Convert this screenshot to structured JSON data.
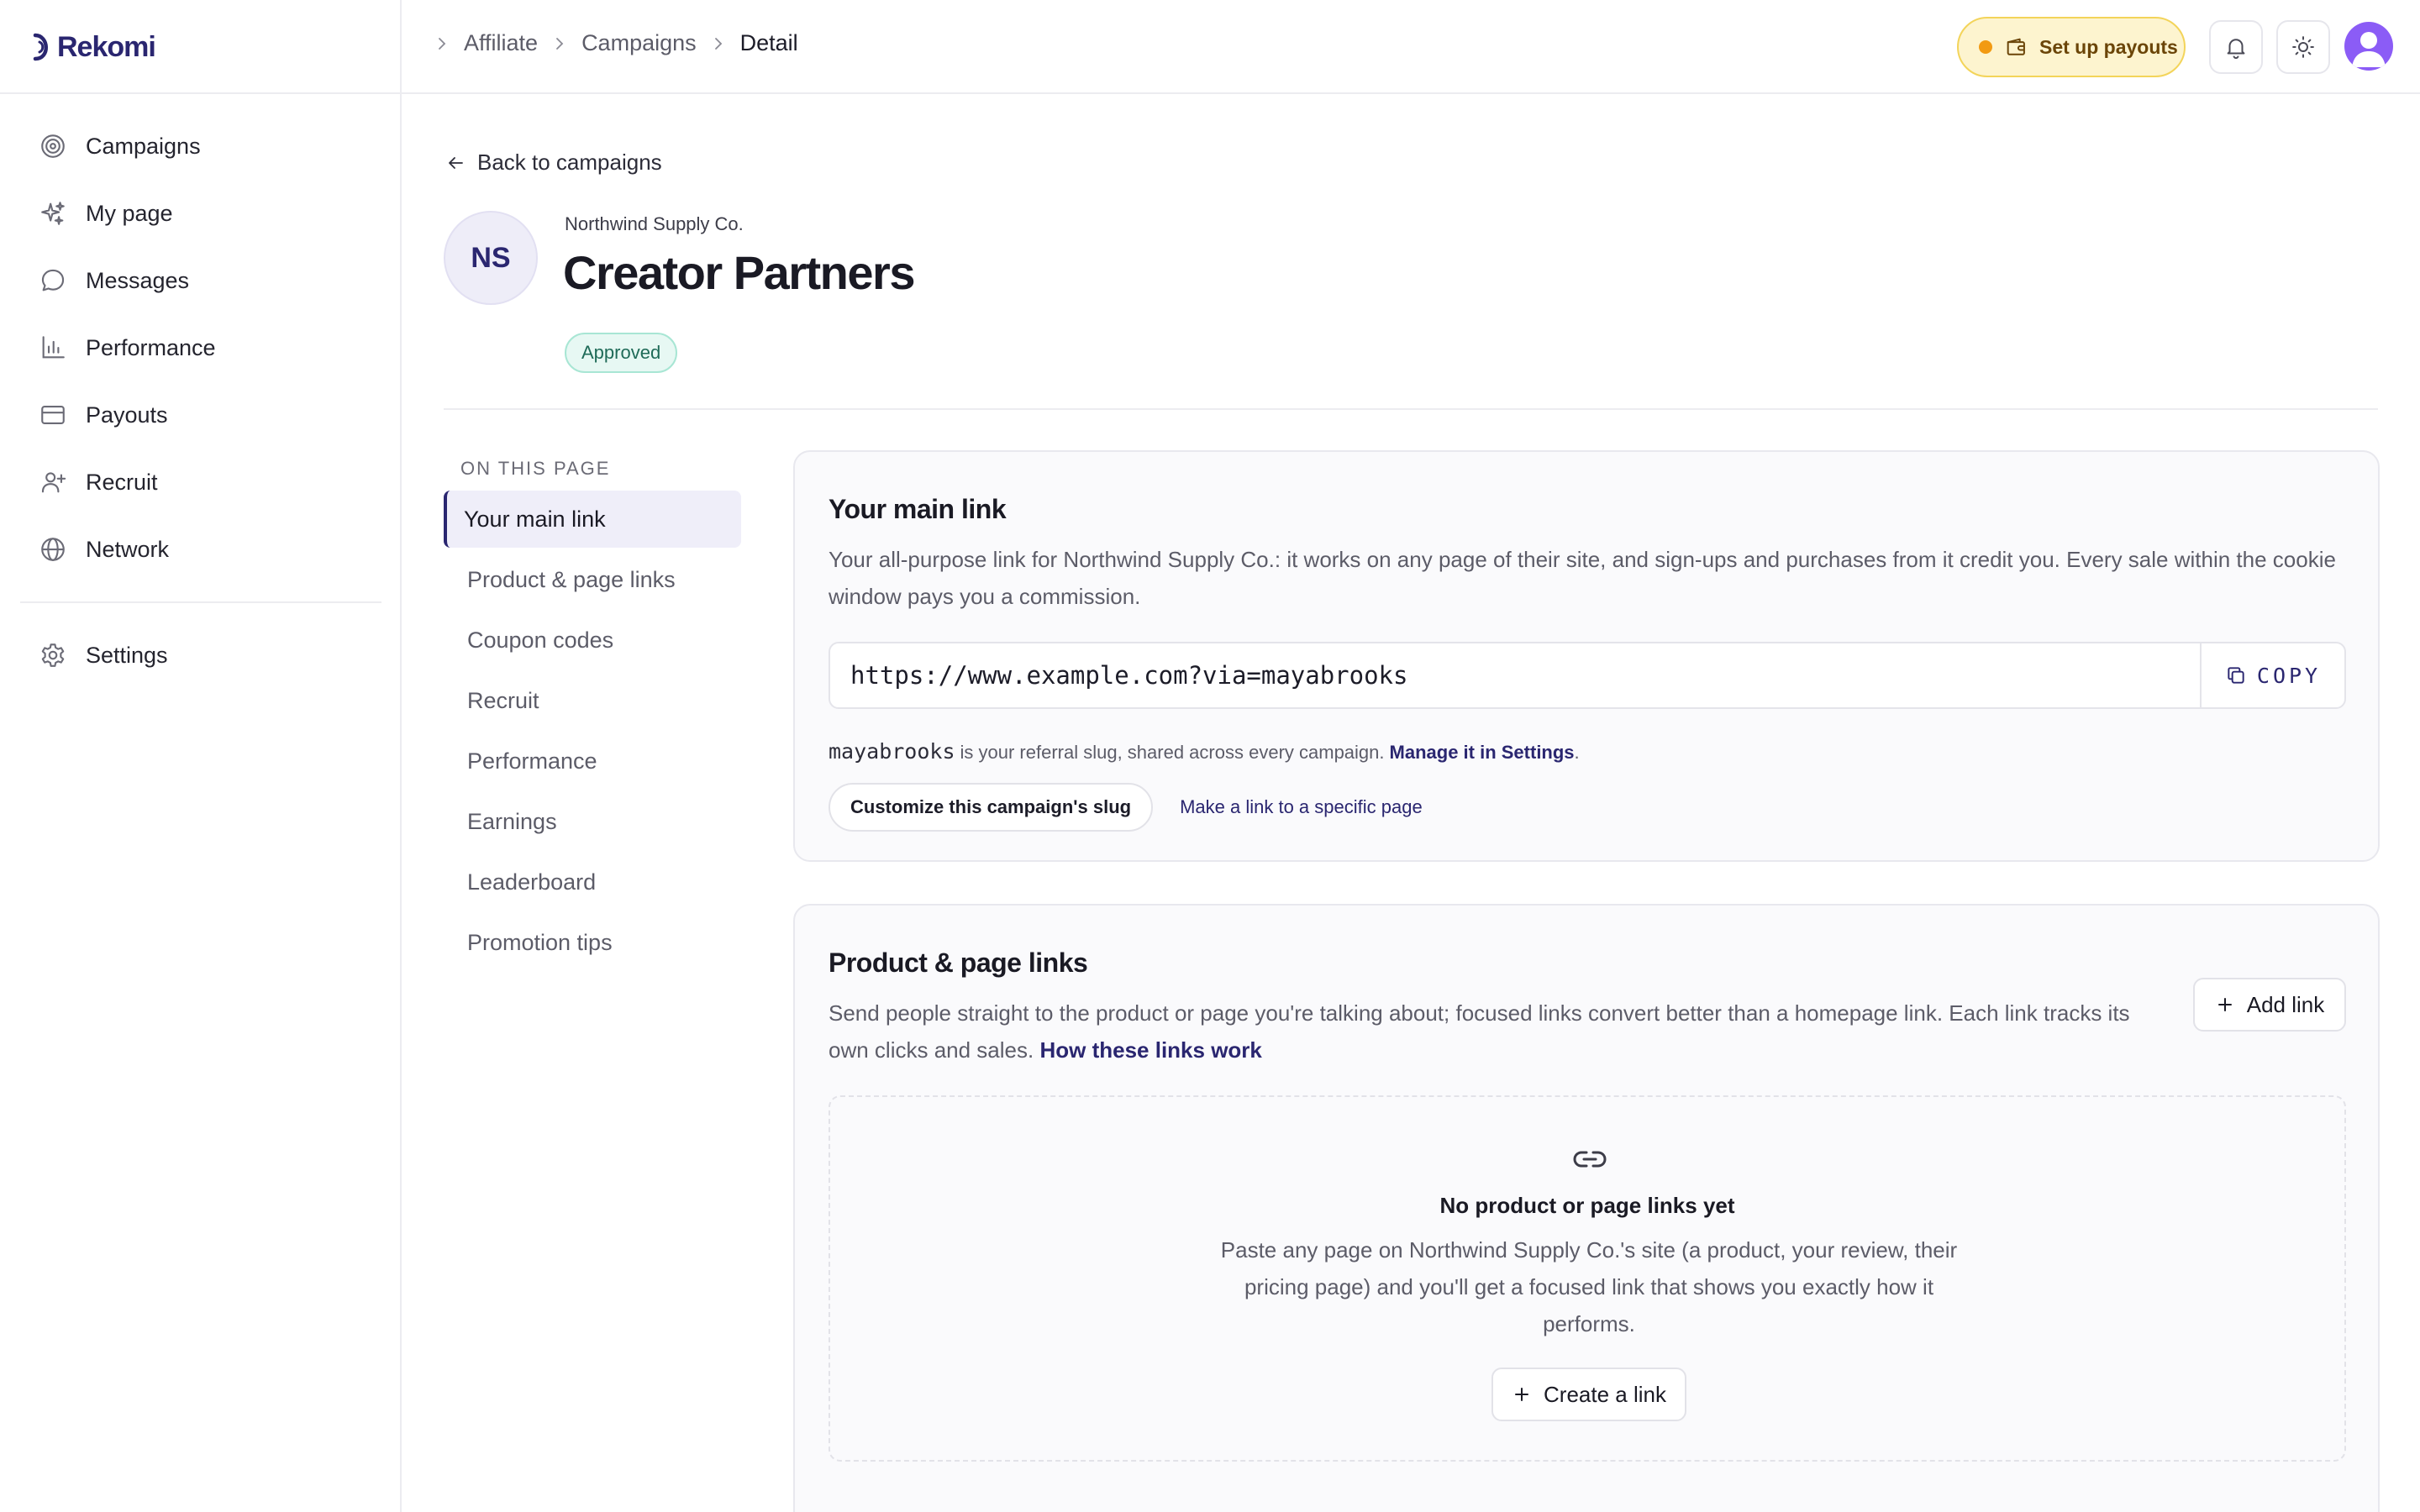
{
  "brand": {
    "logo_text": "Rekomi"
  },
  "sidebar": {
    "items": [
      {
        "label": "Campaigns",
        "icon": "target-icon"
      },
      {
        "label": "My page",
        "icon": "sparkles-icon"
      },
      {
        "label": "Messages",
        "icon": "chat-bubble-icon"
      },
      {
        "label": "Performance",
        "icon": "bar-chart-icon"
      },
      {
        "label": "Payouts",
        "icon": "credit-card-icon"
      },
      {
        "label": "Recruit",
        "icon": "user-plus-icon"
      },
      {
        "label": "Network",
        "icon": "globe-icon"
      }
    ],
    "bottom_items": [
      {
        "label": "Settings",
        "icon": "gear-icon"
      }
    ]
  },
  "topbar": {
    "breadcrumb": [
      "Affiliate",
      "Campaigns",
      "Detail"
    ],
    "payout_button": "Set up payouts",
    "colors": {
      "payout_bg": "#fdf4cf",
      "payout_dot": "#f29a12",
      "avatar": "#8b5cf6"
    }
  },
  "header": {
    "back_label": "Back to campaigns",
    "brand_initials": "NS",
    "company": "Northwind Supply Co.",
    "title": "Creator Partners",
    "status": "Approved"
  },
  "toc": {
    "heading": "ON THIS PAGE",
    "items": [
      "Your main link",
      "Product & page links",
      "Coupon codes",
      "Recruit",
      "Performance",
      "Earnings",
      "Leaderboard",
      "Promotion tips"
    ],
    "active": "Your main link"
  },
  "main_link": {
    "title": "Your main link",
    "description": "Your all-purpose link for Northwind Supply Co.: it works on any page of their site, and sign-ups and purchases from it credit you. Every sale within the cookie window pays you a commission.",
    "url": "https://www.example.com?via=mayabrooks",
    "copy_label": "COPY",
    "slug": "mayabrooks",
    "slug_text": "is your referral slug, shared across every campaign.",
    "settings_link": "Manage it in Settings",
    "settings_period": ".",
    "customize_button": "Customize this campaign's slug",
    "specific_page_link": "Make a link to a specific page"
  },
  "product_links": {
    "title": "Product & page links",
    "description": "Send people straight to the product or page you're talking about; focused links convert better than a homepage link. Each link tracks its own clicks and sales.",
    "how_link": "How these links work",
    "add_button": "Add link",
    "empty_title": "No product or page links yet",
    "empty_description": "Paste any page on Northwind Supply Co.'s site (a product, your review, their pricing page) and you'll get a focused link that shows you exactly how it performs.",
    "create_button": "Create a link"
  }
}
